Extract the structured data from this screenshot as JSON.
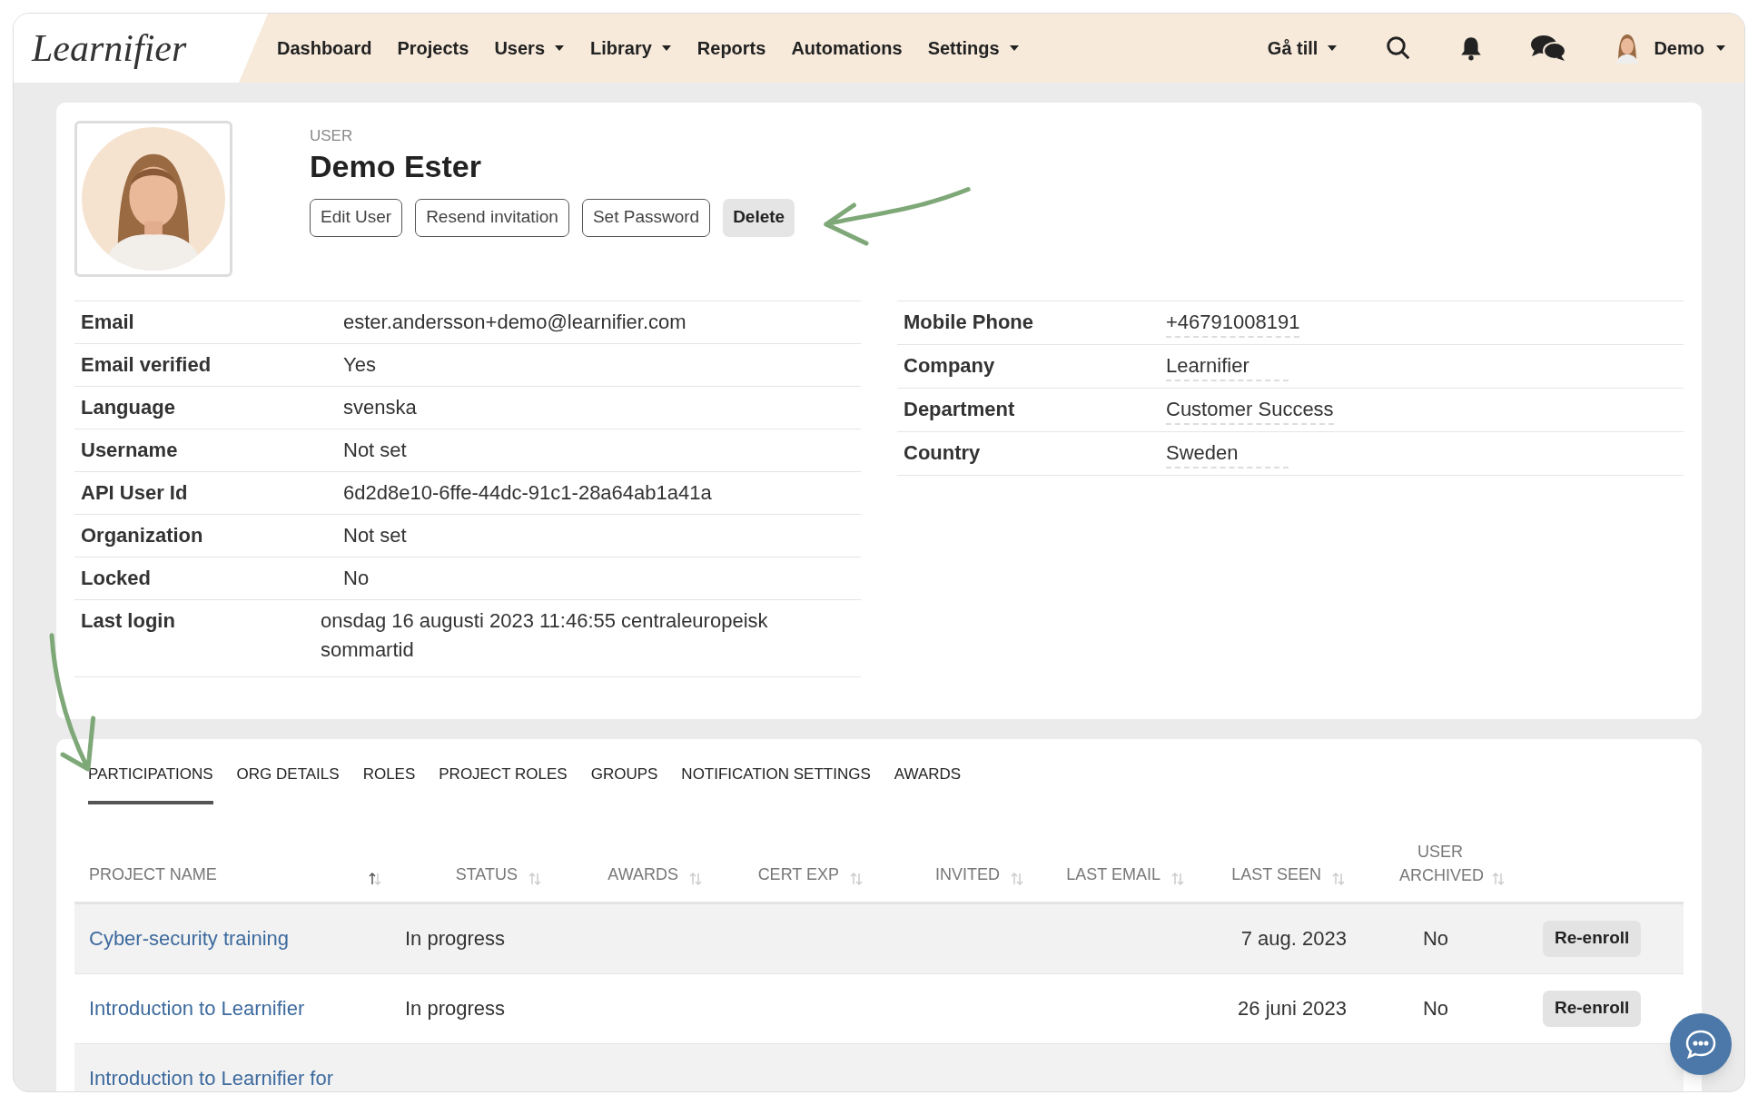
{
  "nav": {
    "logo": "Learnifier",
    "items": [
      {
        "label": "Dashboard",
        "dropdown": false
      },
      {
        "label": "Projects",
        "dropdown": false
      },
      {
        "label": "Users",
        "dropdown": true
      },
      {
        "label": "Library",
        "dropdown": true
      },
      {
        "label": "Reports",
        "dropdown": false
      },
      {
        "label": "Automations",
        "dropdown": false
      },
      {
        "label": "Settings",
        "dropdown": true
      }
    ],
    "goto": "Gå till",
    "user": "Demo"
  },
  "profile": {
    "kicker": "USER",
    "name": "Demo Ester",
    "buttons": [
      {
        "label": "Edit User",
        "kind": "outline"
      },
      {
        "label": "Resend invitation",
        "kind": "outline"
      },
      {
        "label": "Set Password",
        "kind": "outline"
      },
      {
        "label": "Delete",
        "kind": "filled"
      }
    ]
  },
  "details_left": [
    {
      "label": "Email",
      "value": "ester.andersson+demo@learnifier.com"
    },
    {
      "label": "Email verified",
      "value": "Yes"
    },
    {
      "label": "Language",
      "value": "svenska"
    },
    {
      "label": "Username",
      "value": "Not set"
    },
    {
      "label": "API User Id",
      "value": "6d2d8e10-6ffe-44dc-91c1-28a64ab1a41a"
    },
    {
      "label": "Organization",
      "value": "Not set"
    },
    {
      "label": "Locked",
      "value": "No"
    },
    {
      "label": "Last login",
      "value": "onsdag 16 augusti 2023 11:46:55 centraleuropeisk sommartid"
    }
  ],
  "details_right": [
    {
      "label": "Mobile Phone",
      "value": "+46791008191"
    },
    {
      "label": "Company",
      "value": "Learnifier"
    },
    {
      "label": "Department",
      "value": "Customer Success"
    },
    {
      "label": "Country",
      "value": "Sweden"
    }
  ],
  "tabs": [
    {
      "label": "PARTICIPATIONS",
      "selected": true
    },
    {
      "label": "ORG DETAILS",
      "selected": false
    },
    {
      "label": "ROLES",
      "selected": false
    },
    {
      "label": "PROJECT ROLES",
      "selected": false
    },
    {
      "label": "GROUPS",
      "selected": false
    },
    {
      "label": "NOTIFICATION SETTINGS",
      "selected": false
    },
    {
      "label": "AWARDS",
      "selected": false
    }
  ],
  "table": {
    "columns": [
      {
        "label": "PROJECT NAME",
        "sorted": true
      },
      {
        "label": "STATUS",
        "sorted": false
      },
      {
        "label": "AWARDS",
        "sorted": false
      },
      {
        "label": "CERT EXP",
        "sorted": false
      },
      {
        "label": "INVITED",
        "sorted": false
      },
      {
        "label": "LAST EMAIL",
        "sorted": false
      },
      {
        "label": "LAST SEEN",
        "sorted": false
      },
      {
        "label": "USER ARCHIVED",
        "sorted": false
      }
    ],
    "rows": [
      {
        "project": "Cyber-security training",
        "status": "In progress",
        "last_seen": "7 aug. 2023",
        "user_archived": "No",
        "action": "Re-enroll"
      },
      {
        "project": "Introduction to Learnifier",
        "status": "In progress",
        "last_seen": "26 juni 2023",
        "user_archived": "No",
        "action": "Re-enroll"
      },
      {
        "project": "Introduction to Learnifier for"
      }
    ]
  }
}
